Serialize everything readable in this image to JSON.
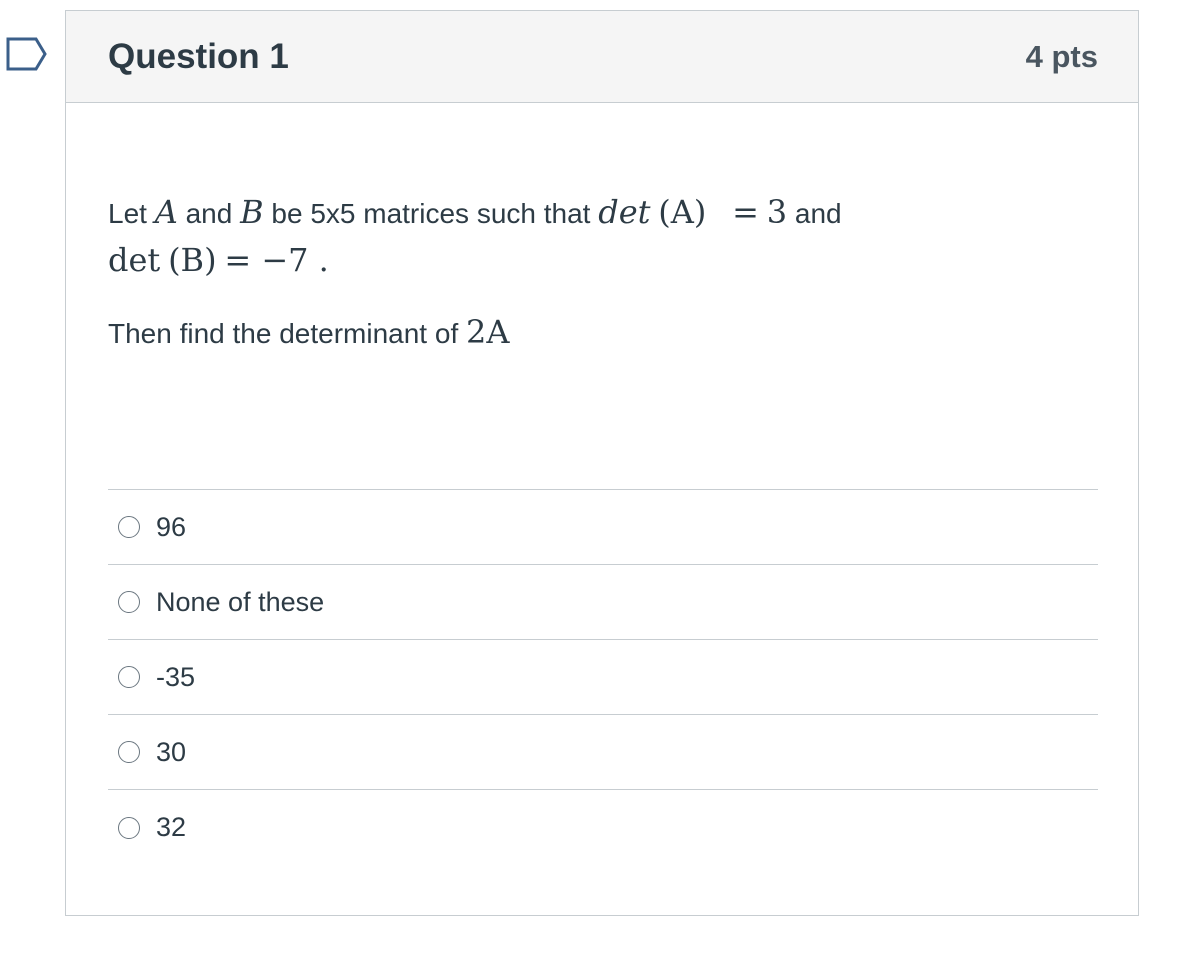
{
  "question": {
    "title": "Question 1",
    "points": "4 pts",
    "text": {
      "let": "Let",
      "var_a": "A",
      "and1": "and",
      "var_b": "B",
      "be": "be 5x5 matrices such that",
      "det_italic": "det",
      "paren_a": "(A)",
      "eq": "=",
      "val_a": "3",
      "and2": "and",
      "det_roman": "det",
      "paren_b": "(B)",
      "val_b": "= −7 .",
      "then": "Then find the determinant of",
      "expr": "2A"
    }
  },
  "answers": [
    {
      "label": "96"
    },
    {
      "label": "None of these"
    },
    {
      "label": "-35"
    },
    {
      "label": "30"
    },
    {
      "label": "32"
    }
  ],
  "colors": {
    "border": "#c7cdd1",
    "header_bg": "#f5f5f5",
    "text": "#2d3b45",
    "flag": "#3b5f8a"
  },
  "icons": {
    "flag": "bookmark-flag-icon",
    "radio": "radio-unchecked-icon"
  }
}
